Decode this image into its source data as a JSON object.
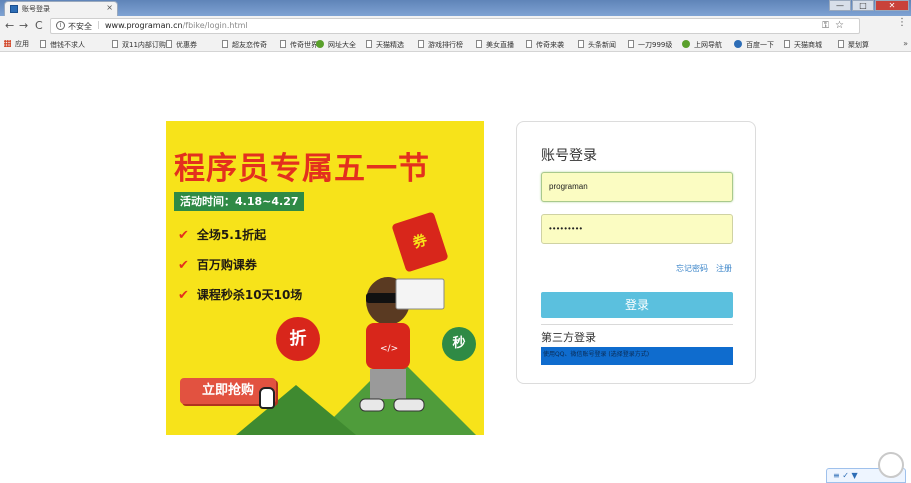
{
  "browser": {
    "tab": {
      "title": "账号登录",
      "close": "×"
    },
    "window_buttons": {
      "minimize": "—",
      "maximize": "□",
      "close": "✕"
    },
    "nav": {
      "back": "←",
      "forward": "→",
      "reload": "C"
    },
    "address": {
      "security_label": "不安全",
      "separator": "|",
      "url_host": "www.programan.cn",
      "url_path": "/fbike/login.html"
    },
    "bookmarks": [
      {
        "label": "应用",
        "icon": "apps-icon"
      },
      {
        "label": "借钱不求人",
        "icon": "page-icon"
      },
      {
        "label": "双11内部订购",
        "icon": "page-icon"
      },
      {
        "label": "优惠券",
        "icon": "page-icon"
      },
      {
        "label": "超友恋传奇",
        "icon": "page-icon"
      },
      {
        "label": "传奇世界",
        "icon": "page-icon"
      },
      {
        "label": "网址大全",
        "icon": "green-icon"
      },
      {
        "label": "天猫精选",
        "icon": "page-icon"
      },
      {
        "label": "游戏排行榜",
        "icon": "page-icon"
      },
      {
        "label": "美女直播",
        "icon": "page-icon"
      },
      {
        "label": "传奇来袭",
        "icon": "page-icon"
      },
      {
        "label": "头条新闻",
        "icon": "page-icon"
      },
      {
        "label": "一刀999级",
        "icon": "page-icon"
      },
      {
        "label": "上网导航",
        "icon": "green-icon"
      },
      {
        "label": "百度一下",
        "icon": "blue-icon"
      },
      {
        "label": "天猫商城",
        "icon": "page-icon"
      },
      {
        "label": "聚划算",
        "icon": "page-icon"
      }
    ],
    "bookmarks_more": "»"
  },
  "banner": {
    "title": "程序员专属五一节",
    "date": "活动时间：4.18~4.27",
    "bullets": [
      "全场5.1折起",
      "百万购课券",
      "课程秒杀10天10场"
    ],
    "check_mark": "✔",
    "coupon": "券",
    "badge_discount": "折",
    "badge_flash": "秒",
    "cta": "立即抢购"
  },
  "login": {
    "title": "账号登录",
    "username_value": "programan",
    "password_value": "•••••••••",
    "forgot_link": "忘记密码",
    "register_link": "注册",
    "submit_label": "登录",
    "third_party_label": "第三方登录",
    "third_party_text": "使用QQ、微信账号登录 (选择登录方式)"
  },
  "widget": {
    "label": "≡  ✓  ▼"
  },
  "colors": {
    "banner_bg": "#f7e31a",
    "banner_red": "#e3301e",
    "banner_green": "#2f8a45",
    "input_autofill": "#fbfcc2",
    "login_button": "#5bc0de",
    "third_party_bar": "#0f6cce",
    "link": "#3a84c9"
  }
}
